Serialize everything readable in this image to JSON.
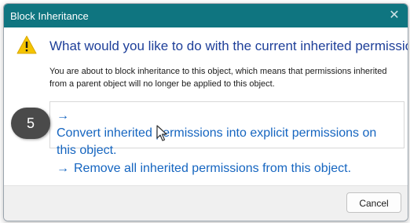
{
  "window": {
    "title": "Block Inheritance",
    "close_glyph": "✕"
  },
  "dialog": {
    "heading": "What would you like to do with the current inherited permissions?",
    "description": "You are about to block inheritance to this object, which means that permissions inherited from a parent object will no longer be applied to this object.",
    "options": [
      {
        "label": "Convert inherited permissions into explicit permissions on this object.",
        "icon": "arrow-right-icon",
        "arrow": "→"
      },
      {
        "label": "Remove all inherited permissions from this object.",
        "icon": "arrow-right-icon",
        "arrow": "→"
      }
    ],
    "warning_icon": "warning-triangle-icon"
  },
  "footer": {
    "cancel_label": "Cancel"
  },
  "annotation": {
    "step_number": "5"
  },
  "colors": {
    "titlebar": "#0f7580",
    "heading": "#1e3f99",
    "link": "#1565c0",
    "warning": "#f5c400",
    "badge": "#4a4a4a"
  }
}
